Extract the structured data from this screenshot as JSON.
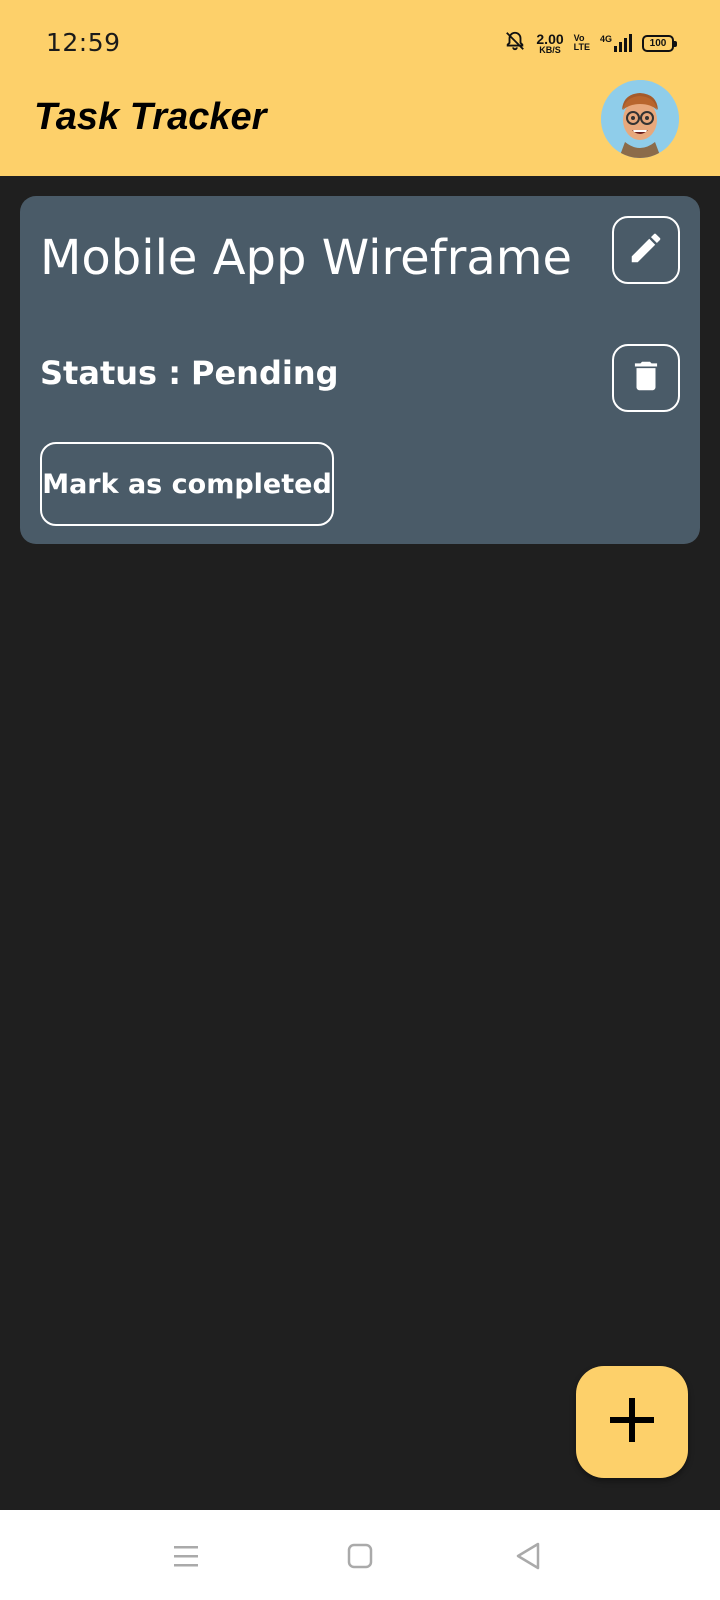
{
  "status_bar": {
    "time": "12:59",
    "speed_value": "2.00",
    "speed_unit": "KB/S",
    "volte_top": "Vo",
    "volte_bottom": "LTE",
    "network": "4G",
    "battery": "100"
  },
  "header": {
    "title": "Task Tracker",
    "avatar_icon": "memoji-avatar-icon"
  },
  "task": {
    "title": "Mobile App Wireframe",
    "status_label": "Status :",
    "status_value": "Pending",
    "mark_button": "Mark as completed",
    "edit_icon": "pencil-icon",
    "delete_icon": "trash-icon"
  },
  "fab": {
    "icon": "plus-icon"
  },
  "nav": {
    "icons": [
      "menu-icon",
      "home-square-icon",
      "back-triangle-icon"
    ]
  },
  "colors": {
    "accent": "#fdd06a",
    "background": "#1f1f1f",
    "card": "#4a5b68"
  }
}
